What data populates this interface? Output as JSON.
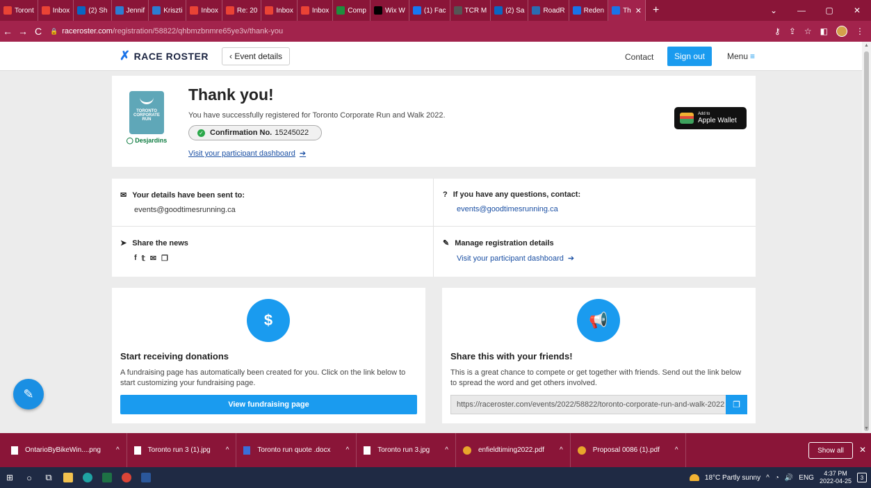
{
  "browser": {
    "tabs": [
      {
        "label": "Toront",
        "icon": "gmail-icon",
        "color": "#ea4335"
      },
      {
        "label": "Inbox",
        "icon": "gmail-icon",
        "color": "#ea4335"
      },
      {
        "label": "(2) Sh",
        "icon": "linkedin-icon",
        "color": "#0a66c2"
      },
      {
        "label": "Jennif",
        "icon": "app-icon",
        "color": "#2d7dd2"
      },
      {
        "label": "Kriszti",
        "icon": "app-icon",
        "color": "#2d7dd2"
      },
      {
        "label": "Inbox",
        "icon": "gmail-icon",
        "color": "#ea4335"
      },
      {
        "label": "Re: 20",
        "icon": "gmail-icon",
        "color": "#ea4335"
      },
      {
        "label": "Inbox",
        "icon": "gmail-icon",
        "color": "#ea4335"
      },
      {
        "label": "Inbox",
        "icon": "gmail-icon",
        "color": "#ea4335"
      },
      {
        "label": "Comp",
        "icon": "chart-icon",
        "color": "#1e8e3e"
      },
      {
        "label": "Wix W",
        "icon": "wix-icon",
        "color": "#000000"
      },
      {
        "label": "(1) Fac",
        "icon": "facebook-icon",
        "color": "#1877f2"
      },
      {
        "label": "TCR M",
        "icon": "app-icon",
        "color": "#555555"
      },
      {
        "label": "(2) Sa",
        "icon": "linkedin-icon",
        "color": "#0a66c2"
      },
      {
        "label": "RoadR",
        "icon": "app-icon",
        "color": "#2b6cb0"
      },
      {
        "label": "Reden",
        "icon": "raceroster-icon",
        "color": "#1a73e8"
      },
      {
        "label": "Th",
        "icon": "raceroster-icon",
        "color": "#1a73e8",
        "active": true
      }
    ],
    "new_tab": "+",
    "url_host": "raceroster.com",
    "url_path": "/registration/58822/qhbmzbnmre65ye3v/thank-you"
  },
  "header": {
    "logo_text": "RACE ROSTER",
    "event_details": "‹ Event details",
    "contact": "Contact",
    "sign_out": "Sign out",
    "menu": "Menu"
  },
  "thankyou": {
    "title": "Thank you!",
    "message": "You have successfully registered for Toronto Corporate Run and Walk 2022.",
    "confirmation_label": "Confirmation No.",
    "confirmation_number": "15245022",
    "dashboard_link": "Visit your participant dashboard",
    "wallet_small": "Add to",
    "wallet_big": "Apple Wallet",
    "brand_text": "TORONTO CORPORATE RUN",
    "brand_sponsor": "Desjardins"
  },
  "details": {
    "sent_to_label": "Your details have been sent to:",
    "sent_to_email": "events@goodtimesrunning.ca",
    "questions_label": "If you have any questions, contact:",
    "questions_email": "events@goodtimesrunning.ca",
    "share_label": "Share the news",
    "manage_label": "Manage registration details",
    "manage_link": "Visit your participant dashboard"
  },
  "donations": {
    "title": "Start receiving donations",
    "text": "A fundraising page has automatically been created for you. Click on the link below to start customizing your fundraising page.",
    "button": "View fundraising page"
  },
  "share": {
    "title": "Share this with your friends!",
    "text": "This is a great chance to compete or get together with friends. Send out the link below to spread the word and get others involved.",
    "url": "https://raceroster.com/events/2022/58822/toronto-corporate-run-and-walk-2022"
  },
  "downloads": {
    "items": [
      {
        "name": "OntarioByBikeWin....png",
        "type": "image"
      },
      {
        "name": "Toronto run 3 (1).jpg",
        "type": "image"
      },
      {
        "name": "Toronto run quote .docx",
        "type": "word"
      },
      {
        "name": "Toronto run 3.jpg",
        "type": "image"
      },
      {
        "name": "enfieldtiming2022.pdf",
        "type": "pdf"
      },
      {
        "name": "Proposal 0086 (1).pdf",
        "type": "pdf"
      }
    ],
    "show_all": "Show all"
  },
  "taskbar": {
    "weather": "18°C  Partly sunny",
    "lang": "ENG",
    "time": "4:37 PM",
    "date": "2022-04-25",
    "notifications": "3"
  }
}
